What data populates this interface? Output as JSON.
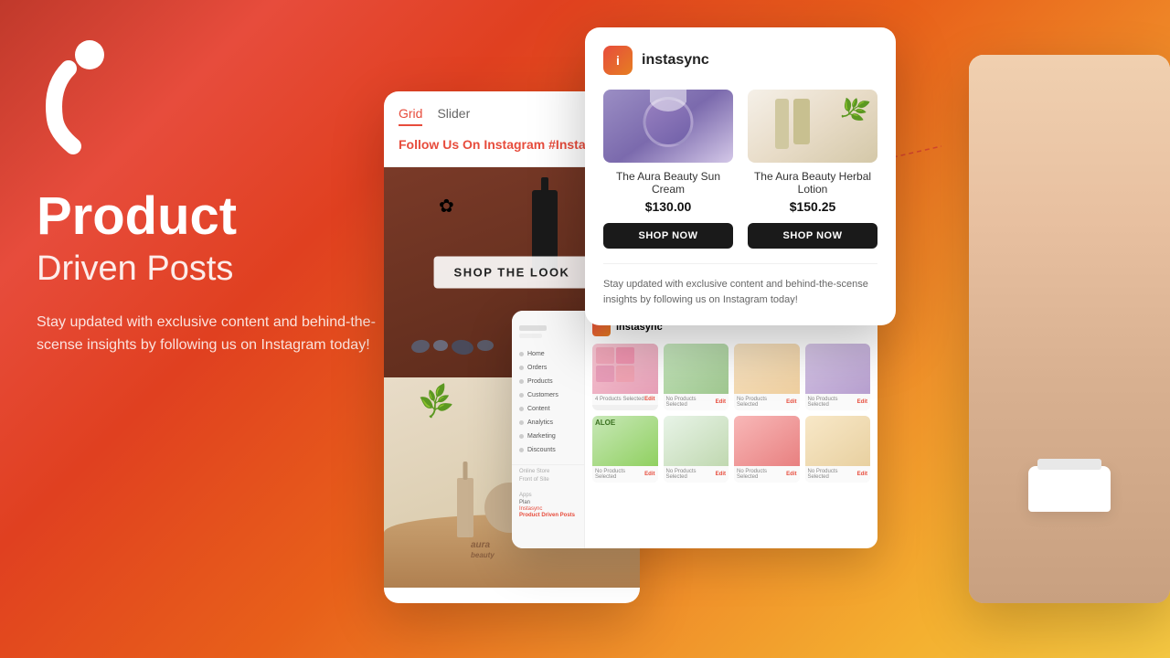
{
  "logo": {
    "icon": "i"
  },
  "hero": {
    "headline": "Product",
    "subheadline": "Driven Posts",
    "description": "Stay updated with exclusive content and behind-the-scense insights by following us on Instagram today!"
  },
  "feed_card": {
    "tab_grid": "Grid",
    "tab_slider": "Slider",
    "follow_text": "Follow Us On Instagram",
    "follow_hashtag": "#Instasync",
    "shop_the_look": "SHOP THE LOOK"
  },
  "popup": {
    "app_name": "instasync",
    "products": [
      {
        "name": "The Aura Beauty Sun Cream",
        "price": "$130.00",
        "btn": "SHOP NOW"
      },
      {
        "name": "The Aura Beauty Herbal Lotion",
        "price": "$150.25",
        "btn": "SHOP NOW"
      }
    ],
    "footer_text": "Stay updated with exclusive content and behind-the-scense insights by following us on Instagram today!"
  },
  "admin": {
    "title": "instasync",
    "nav_items": [
      "Home",
      "Orders",
      "Products",
      "Customers",
      "Content",
      "Analytics",
      "Marketing",
      "Discounts"
    ],
    "grid_labels": [
      "4 Products Selected",
      "No Products Selected",
      "No Products Selected",
      "No Products Selected",
      "No Products Selected",
      "No Products Selected",
      "No Products Selected",
      "No Products Selected"
    ],
    "edit_labels": [
      "Edit",
      "Edit",
      "Edit",
      "Edit",
      "Edit",
      "Edit",
      "Edit",
      "Edit"
    ]
  },
  "colors": {
    "brand_red": "#e74c3c",
    "brand_orange": "#e67e22",
    "dark": "#1a1a1a",
    "text_muted": "#666666"
  }
}
